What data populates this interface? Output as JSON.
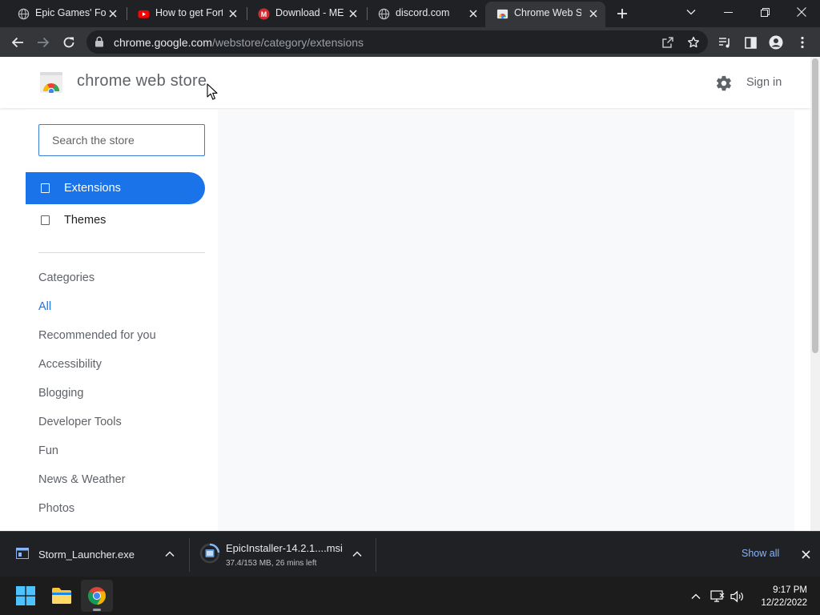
{
  "browser": {
    "tabs": [
      {
        "title": "Epic Games' Fortnite",
        "favicon": "globe-icon"
      },
      {
        "title": "How to get Fortnite",
        "favicon": "youtube-icon"
      },
      {
        "title": "Download - MEGA",
        "favicon": "mega-icon"
      },
      {
        "title": "discord.com",
        "favicon": "globe-icon"
      },
      {
        "title": "Chrome Web Store",
        "favicon": "chrome-web-store-icon",
        "active": true
      }
    ],
    "url_host": "chrome.google.com",
    "url_path": "/webstore/category/extensions"
  },
  "store": {
    "title": "chrome web store",
    "signin_label": "Sign in",
    "search_placeholder": "Search the store",
    "nav": [
      {
        "label": "Extensions",
        "selected": true
      },
      {
        "label": "Themes",
        "selected": false
      }
    ],
    "categories_title": "Categories",
    "categories": [
      {
        "label": "All",
        "active": true
      },
      {
        "label": "Recommended for you"
      },
      {
        "label": "Accessibility"
      },
      {
        "label": "Blogging"
      },
      {
        "label": "Developer Tools"
      },
      {
        "label": "Fun"
      },
      {
        "label": "News & Weather"
      },
      {
        "label": "Photos"
      }
    ]
  },
  "downloads": {
    "items": [
      {
        "name": "Storm_Launcher.exe",
        "status": ""
      },
      {
        "name": "EpicInstaller-14.2.1....msi",
        "status": "37.4/153 MB, 26 mins left"
      }
    ],
    "show_all_label": "Show all"
  },
  "taskbar": {
    "time": "9:17 PM",
    "date": "12/22/2022"
  },
  "colors": {
    "accent": "#1a73e8",
    "chrome_dark": "#202124",
    "toolbar": "#35363a",
    "link": "#8ab4f8"
  }
}
